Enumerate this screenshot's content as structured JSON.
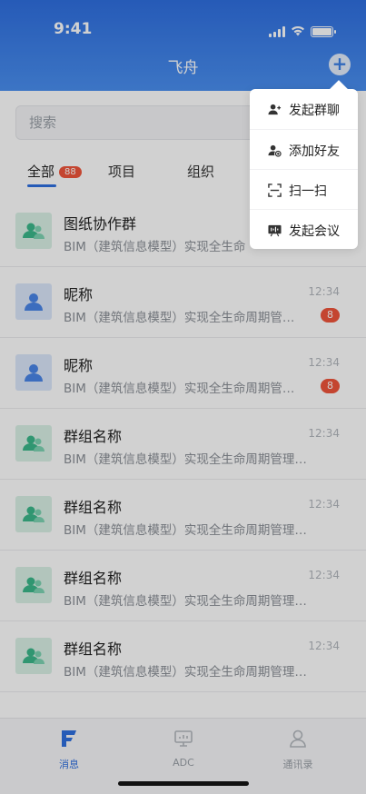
{
  "status_bar": {
    "time": "9:41"
  },
  "header": {
    "title": "飞舟"
  },
  "search": {
    "placeholder": "搜索"
  },
  "tabs": [
    {
      "label": "全部",
      "badge": "88"
    },
    {
      "label": "项目"
    },
    {
      "label": "组织"
    }
  ],
  "conversations": [
    {
      "type": "group",
      "name": "图纸协作群",
      "message": "BIM（建筑信息模型）实现全生命",
      "time": "",
      "badge": ""
    },
    {
      "type": "person",
      "name": "昵称",
      "message": "BIM（建筑信息模型）实现全生命周期管…",
      "time": "12:34",
      "badge": "8"
    },
    {
      "type": "person",
      "name": "昵称",
      "message": "BIM（建筑信息模型）实现全生命周期管…",
      "time": "12:34",
      "badge": "8"
    },
    {
      "type": "group",
      "name": "群组名称",
      "message": "BIM（建筑信息模型）实现全生命周期管理，参…",
      "time": "12:34",
      "badge": ""
    },
    {
      "type": "group",
      "name": "群组名称",
      "message": "BIM（建筑信息模型）实现全生命周期管理，参…",
      "time": "12:34",
      "badge": ""
    },
    {
      "type": "group",
      "name": "群组名称",
      "message": "BIM（建筑信息模型）实现全生命周期管理，参…",
      "time": "12:34",
      "badge": ""
    },
    {
      "type": "group",
      "name": "群组名称",
      "message": "BIM（建筑信息模型）实现全生命周期管理，参…",
      "time": "12:34",
      "badge": ""
    }
  ],
  "menu": [
    {
      "label": "发起群聊",
      "icon": "group-chat-icon"
    },
    {
      "label": "添加好友",
      "icon": "add-friend-icon"
    },
    {
      "label": "扫一扫",
      "icon": "scan-icon"
    },
    {
      "label": "发起会议",
      "icon": "meeting-icon"
    }
  ],
  "bottom_nav": [
    {
      "label": "消息",
      "icon": "messages-icon",
      "active": true
    },
    {
      "label": "ADC",
      "icon": "adc-icon",
      "active": false
    },
    {
      "label": "通讯录",
      "icon": "contacts-icon",
      "active": false
    }
  ],
  "colors": {
    "primary": "#2f6fe0",
    "badge": "#f0553b"
  }
}
